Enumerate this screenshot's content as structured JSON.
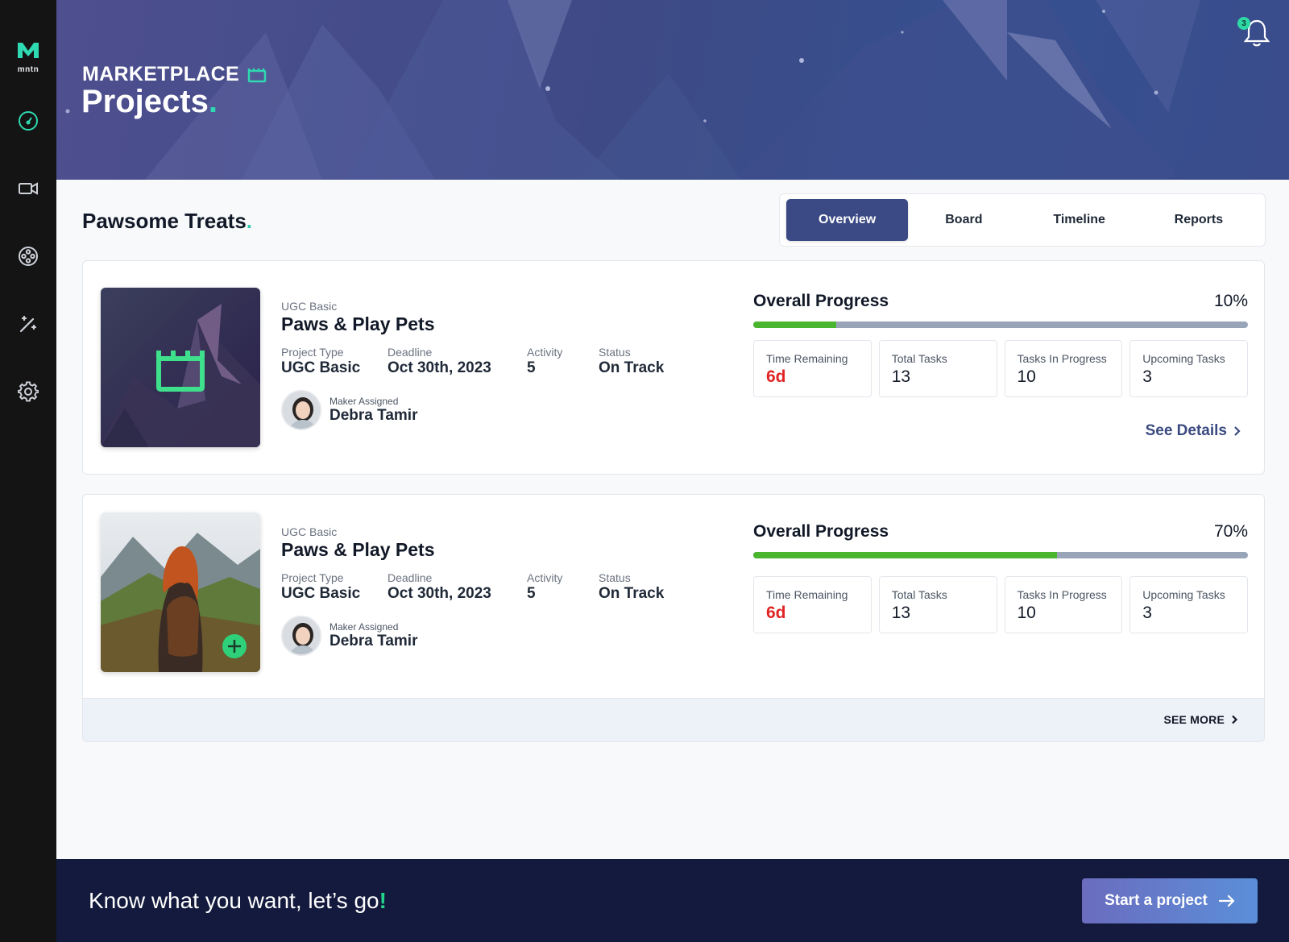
{
  "brand": {
    "mark": "M",
    "name": "mntn",
    "accent": "#2fd9b1"
  },
  "sidebar": {
    "items": [
      {
        "icon": "dashboard-gauge-icon"
      },
      {
        "icon": "video-camera-icon"
      },
      {
        "icon": "film-reel-icon"
      },
      {
        "icon": "magic-wand-icon"
      },
      {
        "icon": "gear-icon"
      }
    ]
  },
  "hero": {
    "kicker": "MARKETPLACE",
    "title": "Projects",
    "title_dot": ".",
    "notifications_count": "3"
  },
  "project": {
    "name": "Pawsome Treats",
    "name_dot": "."
  },
  "tabs": [
    {
      "label": "Overview",
      "active": true
    },
    {
      "label": "Board",
      "active": false
    },
    {
      "label": "Timeline",
      "active": false
    },
    {
      "label": "Reports",
      "active": false
    }
  ],
  "cards": [
    {
      "category": "UGC Basic",
      "title": "Paws & Play Pets",
      "meta": {
        "project_type_label": "Project Type",
        "project_type": "UGC Basic",
        "deadline_label": "Deadline",
        "deadline": "Oct 30th, 2023",
        "activity_label": "Activity",
        "activity": "5",
        "status_label": "Status",
        "status": "On Track"
      },
      "maker_label": "Maker Assigned",
      "maker_name": "Debra Tamir",
      "progress_title": "Overall Progress",
      "progress_pct": "10%",
      "progress_fraction": 0.167,
      "stats": [
        {
          "label": "Time Remaining",
          "value": "6d"
        },
        {
          "label": "Total Tasks",
          "value": "13"
        },
        {
          "label": "Tasks In Progress",
          "value": "10"
        },
        {
          "label": "Upcoming Tasks",
          "value": "3"
        }
      ],
      "link": "See Details"
    },
    {
      "category": "UGC Basic",
      "title": "Paws & Play Pets",
      "meta": {
        "project_type_label": "Project Type",
        "project_type": "UGC Basic",
        "deadline_label": "Deadline",
        "deadline": "Oct 30th, 2023",
        "activity_label": "Activity",
        "activity": "5",
        "status_label": "Status",
        "status": "On Track"
      },
      "maker_label": "Maker Assigned",
      "maker_name": "Debra Tamir",
      "progress_title": "Overall Progress",
      "progress_pct": "70%",
      "progress_fraction": 0.614,
      "stats": [
        {
          "label": "Time Remaining",
          "value": "6d"
        },
        {
          "label": "Total Tasks",
          "value": "13"
        },
        {
          "label": "Tasks In Progress",
          "value": "10"
        },
        {
          "label": "Upcoming Tasks",
          "value": "3"
        }
      ],
      "link": "SEE MORE"
    }
  ],
  "banner": {
    "text": "Know what you want, let’s go",
    "bang": "!",
    "cta": "Start a project"
  },
  "colors": {
    "sidebar_bg": "#141414",
    "tab_active": "#3b4a85",
    "progress_fill": "#4ab52f",
    "progress_track": "#98a5b8",
    "time_remaining": "#e02424",
    "banner_bg": "#131a3d"
  }
}
